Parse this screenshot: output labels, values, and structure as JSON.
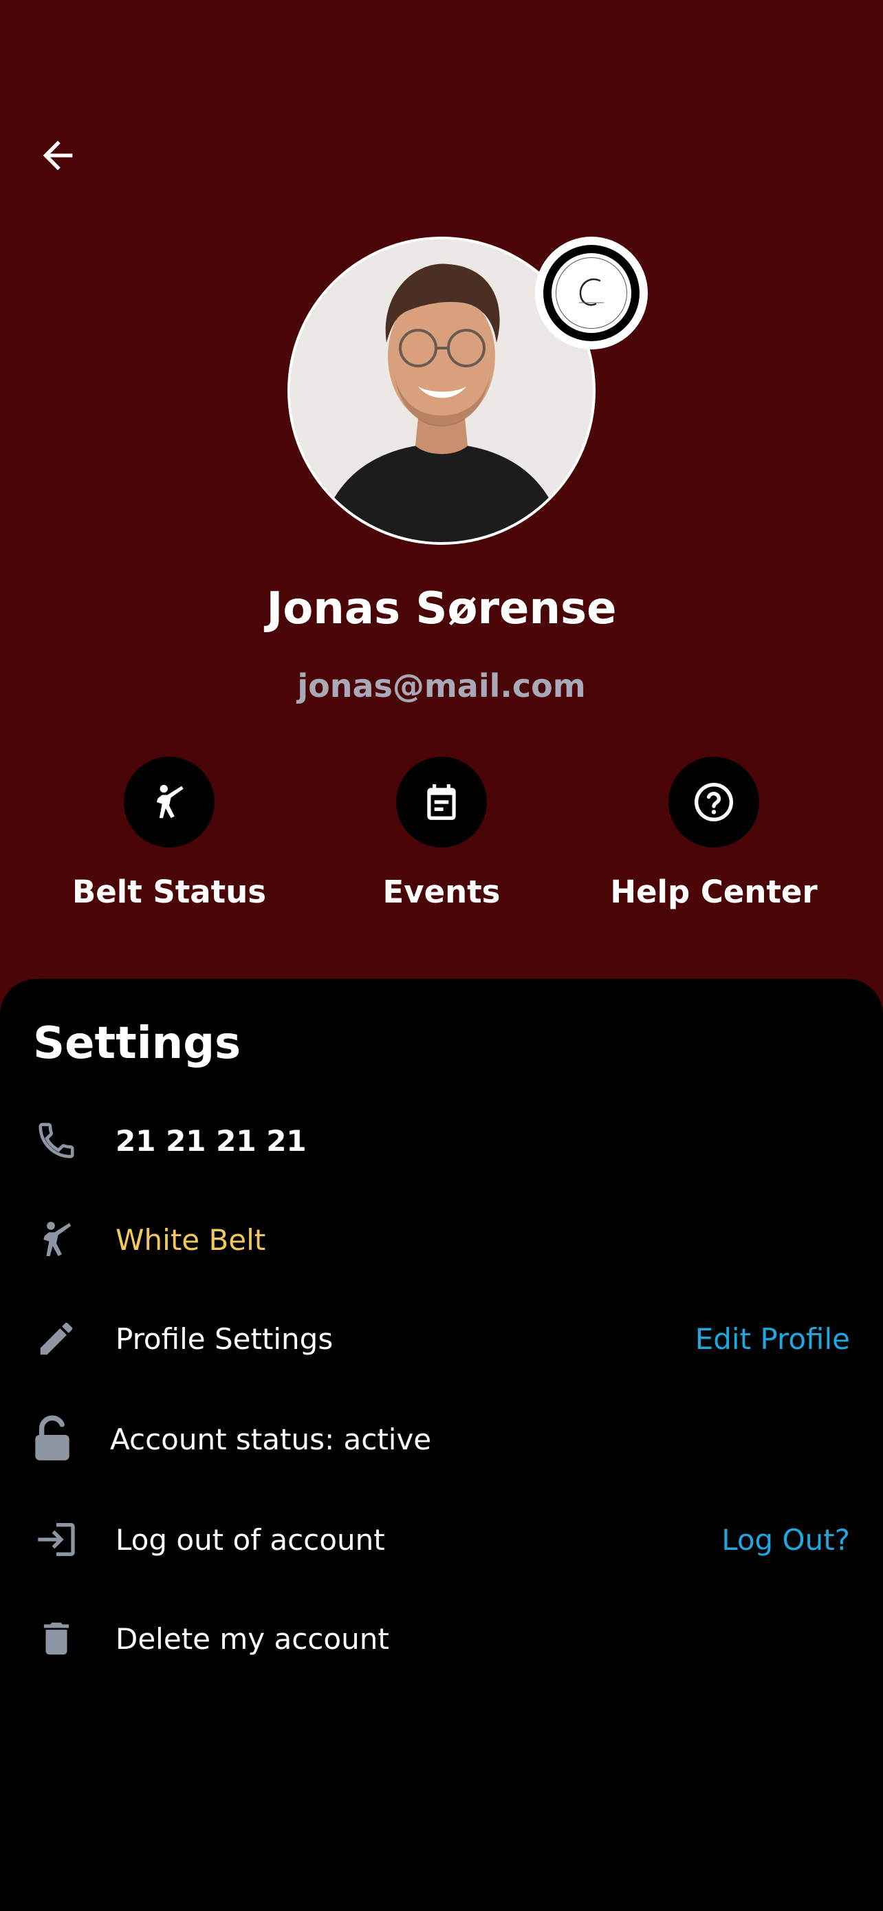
{
  "header": {
    "back_icon": "arrow-left-icon"
  },
  "profile": {
    "name": "Jonas Sørense",
    "email": "jonas@mail.com",
    "badge_icon": "club-logo"
  },
  "actions": [
    {
      "label": "Belt Status",
      "icon": "martial-arts-kick-icon"
    },
    {
      "label": "Events",
      "icon": "calendar-note-icon"
    },
    {
      "label": "Help Center",
      "icon": "question-circle-icon"
    }
  ],
  "settings": {
    "title": "Settings",
    "phone": "21 21 21 21",
    "belt": "White Belt",
    "profile_settings": "Profile Settings",
    "edit_profile_link": "Edit Profile",
    "account_status": "Account status: active",
    "logout_label": "Log out of account",
    "logout_link": "Log Out?",
    "delete_label": "Delete my account"
  },
  "colors": {
    "hero_background": "#4a0606",
    "panel_background": "#000000",
    "belt_text": "#f2c85b",
    "link": "#1fa8e0",
    "email_text": "#a9a9b8",
    "icon_gray": "#8e96a3"
  }
}
